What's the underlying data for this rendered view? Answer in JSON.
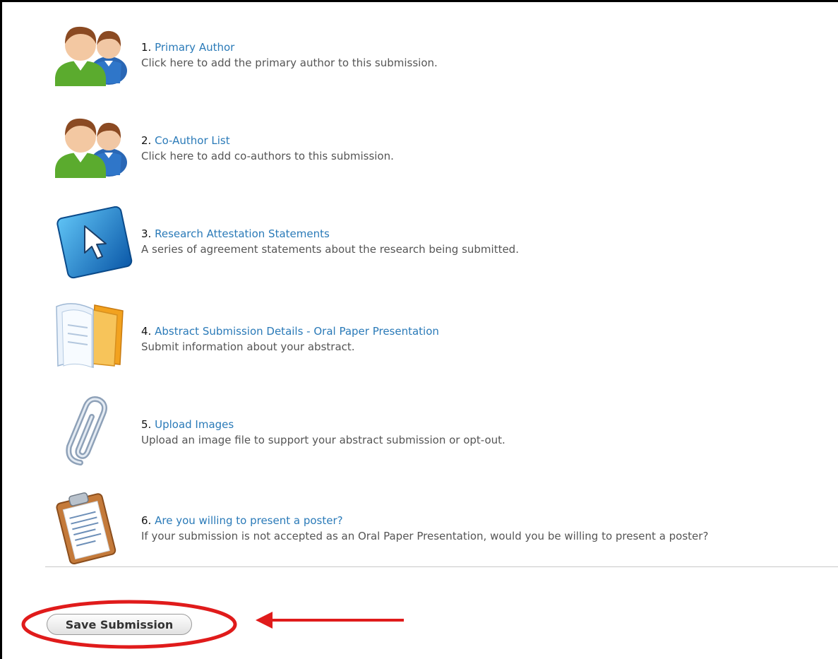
{
  "tasks": [
    {
      "number": "1.",
      "title": "Primary Author",
      "description": "Click here to add the primary author to this submission.",
      "icon": "people-icon"
    },
    {
      "number": "2.",
      "title": "Co-Author List",
      "description": "Click here to add co-authors to this submission.",
      "icon": "people-icon"
    },
    {
      "number": "3.",
      "title": "Research Attestation Statements",
      "description": "A series of agreement statements about the research being submitted.",
      "icon": "cursor-arrow-icon"
    },
    {
      "number": "4.",
      "title": "Abstract Submission Details - Oral Paper Presentation",
      "description": "Submit information about your abstract.",
      "icon": "documents-folder-icon"
    },
    {
      "number": "5.",
      "title": "Upload Images",
      "description": "Upload an image file to support your abstract submission or opt-out.",
      "icon": "paperclip-icon"
    },
    {
      "number": "6.",
      "title": "Are you willing to present a poster?",
      "description": "If your submission is not accepted as an Oral Paper Presentation, would you be willing to present a poster?",
      "icon": "clipboard-icon"
    }
  ],
  "actions": {
    "save_label": "Save Submission"
  },
  "annotation_color": "#e01b1b"
}
